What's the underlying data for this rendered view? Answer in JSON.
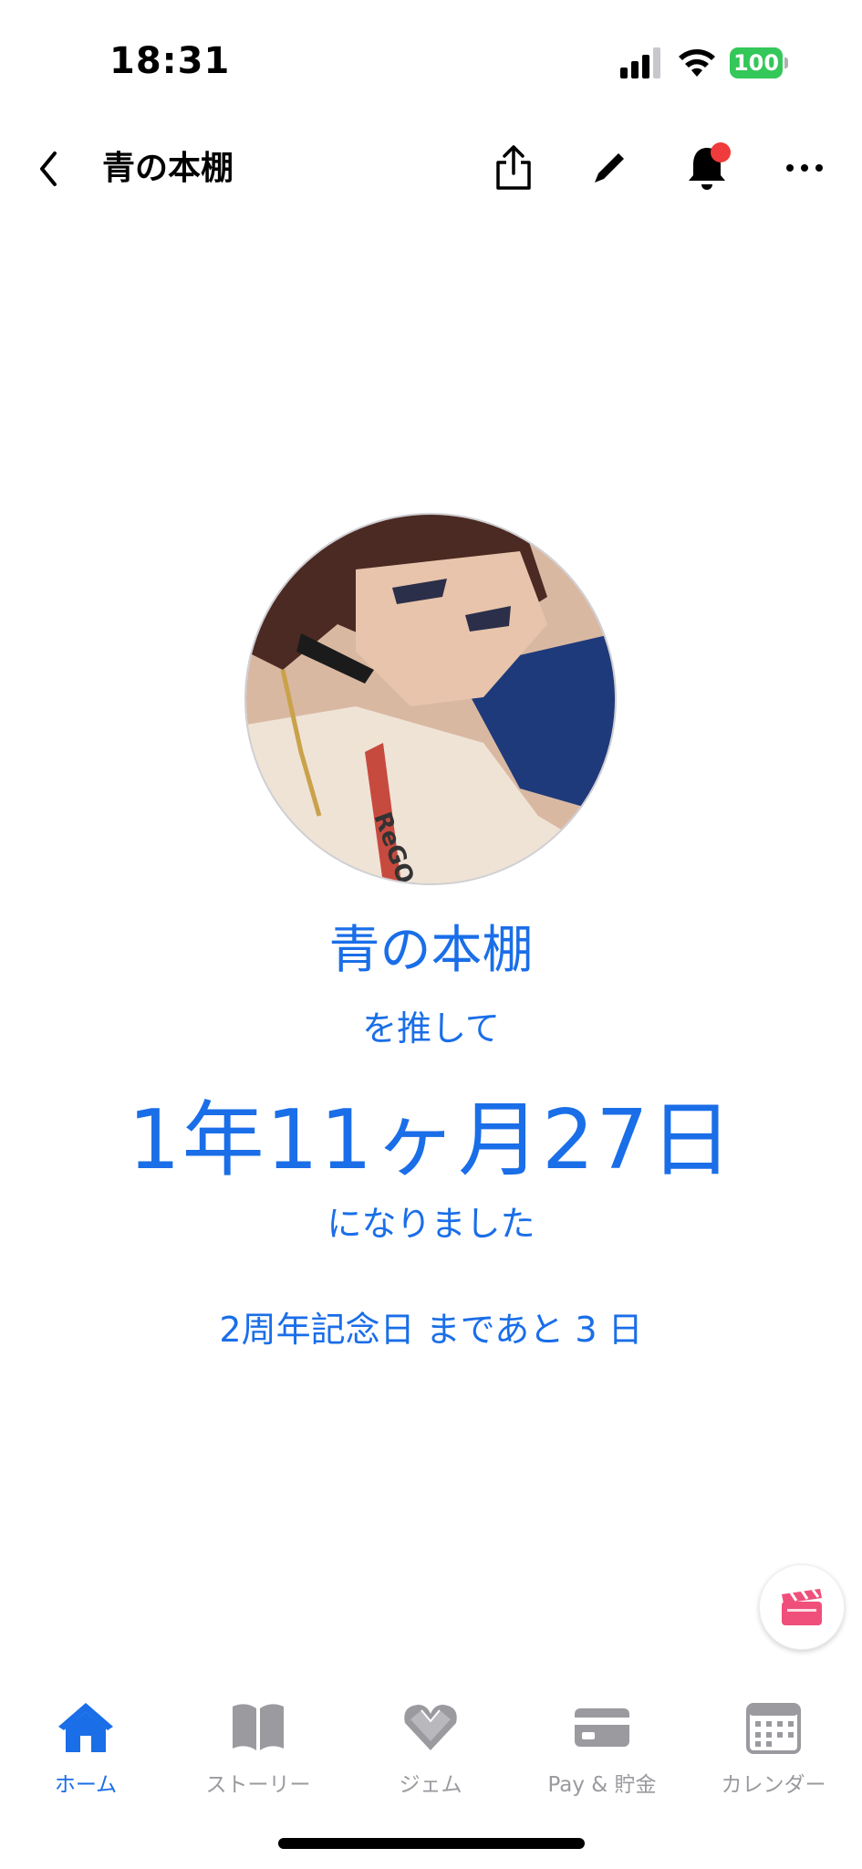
{
  "status": {
    "time": "18:31",
    "battery": "100"
  },
  "nav": {
    "title": "青の本棚"
  },
  "main": {
    "name": "青の本棚",
    "line1": "を推して",
    "duration": "1年11ヶ月27日",
    "line2": "になりました",
    "countdown": "2周年記念日 まであと 3 日"
  },
  "colors": {
    "accent": "#1a6ee8",
    "badge": "#ef3b3b",
    "battery": "#34c759",
    "fab_icon": "#ef4f7a"
  },
  "tabs": [
    {
      "label": "ホーム",
      "icon": "home-icon",
      "active": true
    },
    {
      "label": "ストーリー",
      "icon": "book-icon",
      "active": false
    },
    {
      "label": "ジェム",
      "icon": "gem-heart-icon",
      "active": false
    },
    {
      "label": "Pay & 貯金",
      "icon": "card-icon",
      "active": false
    },
    {
      "label": "カレンダー",
      "icon": "calendar-icon",
      "active": false
    }
  ],
  "fab": {
    "icon": "clapperboard-icon"
  }
}
